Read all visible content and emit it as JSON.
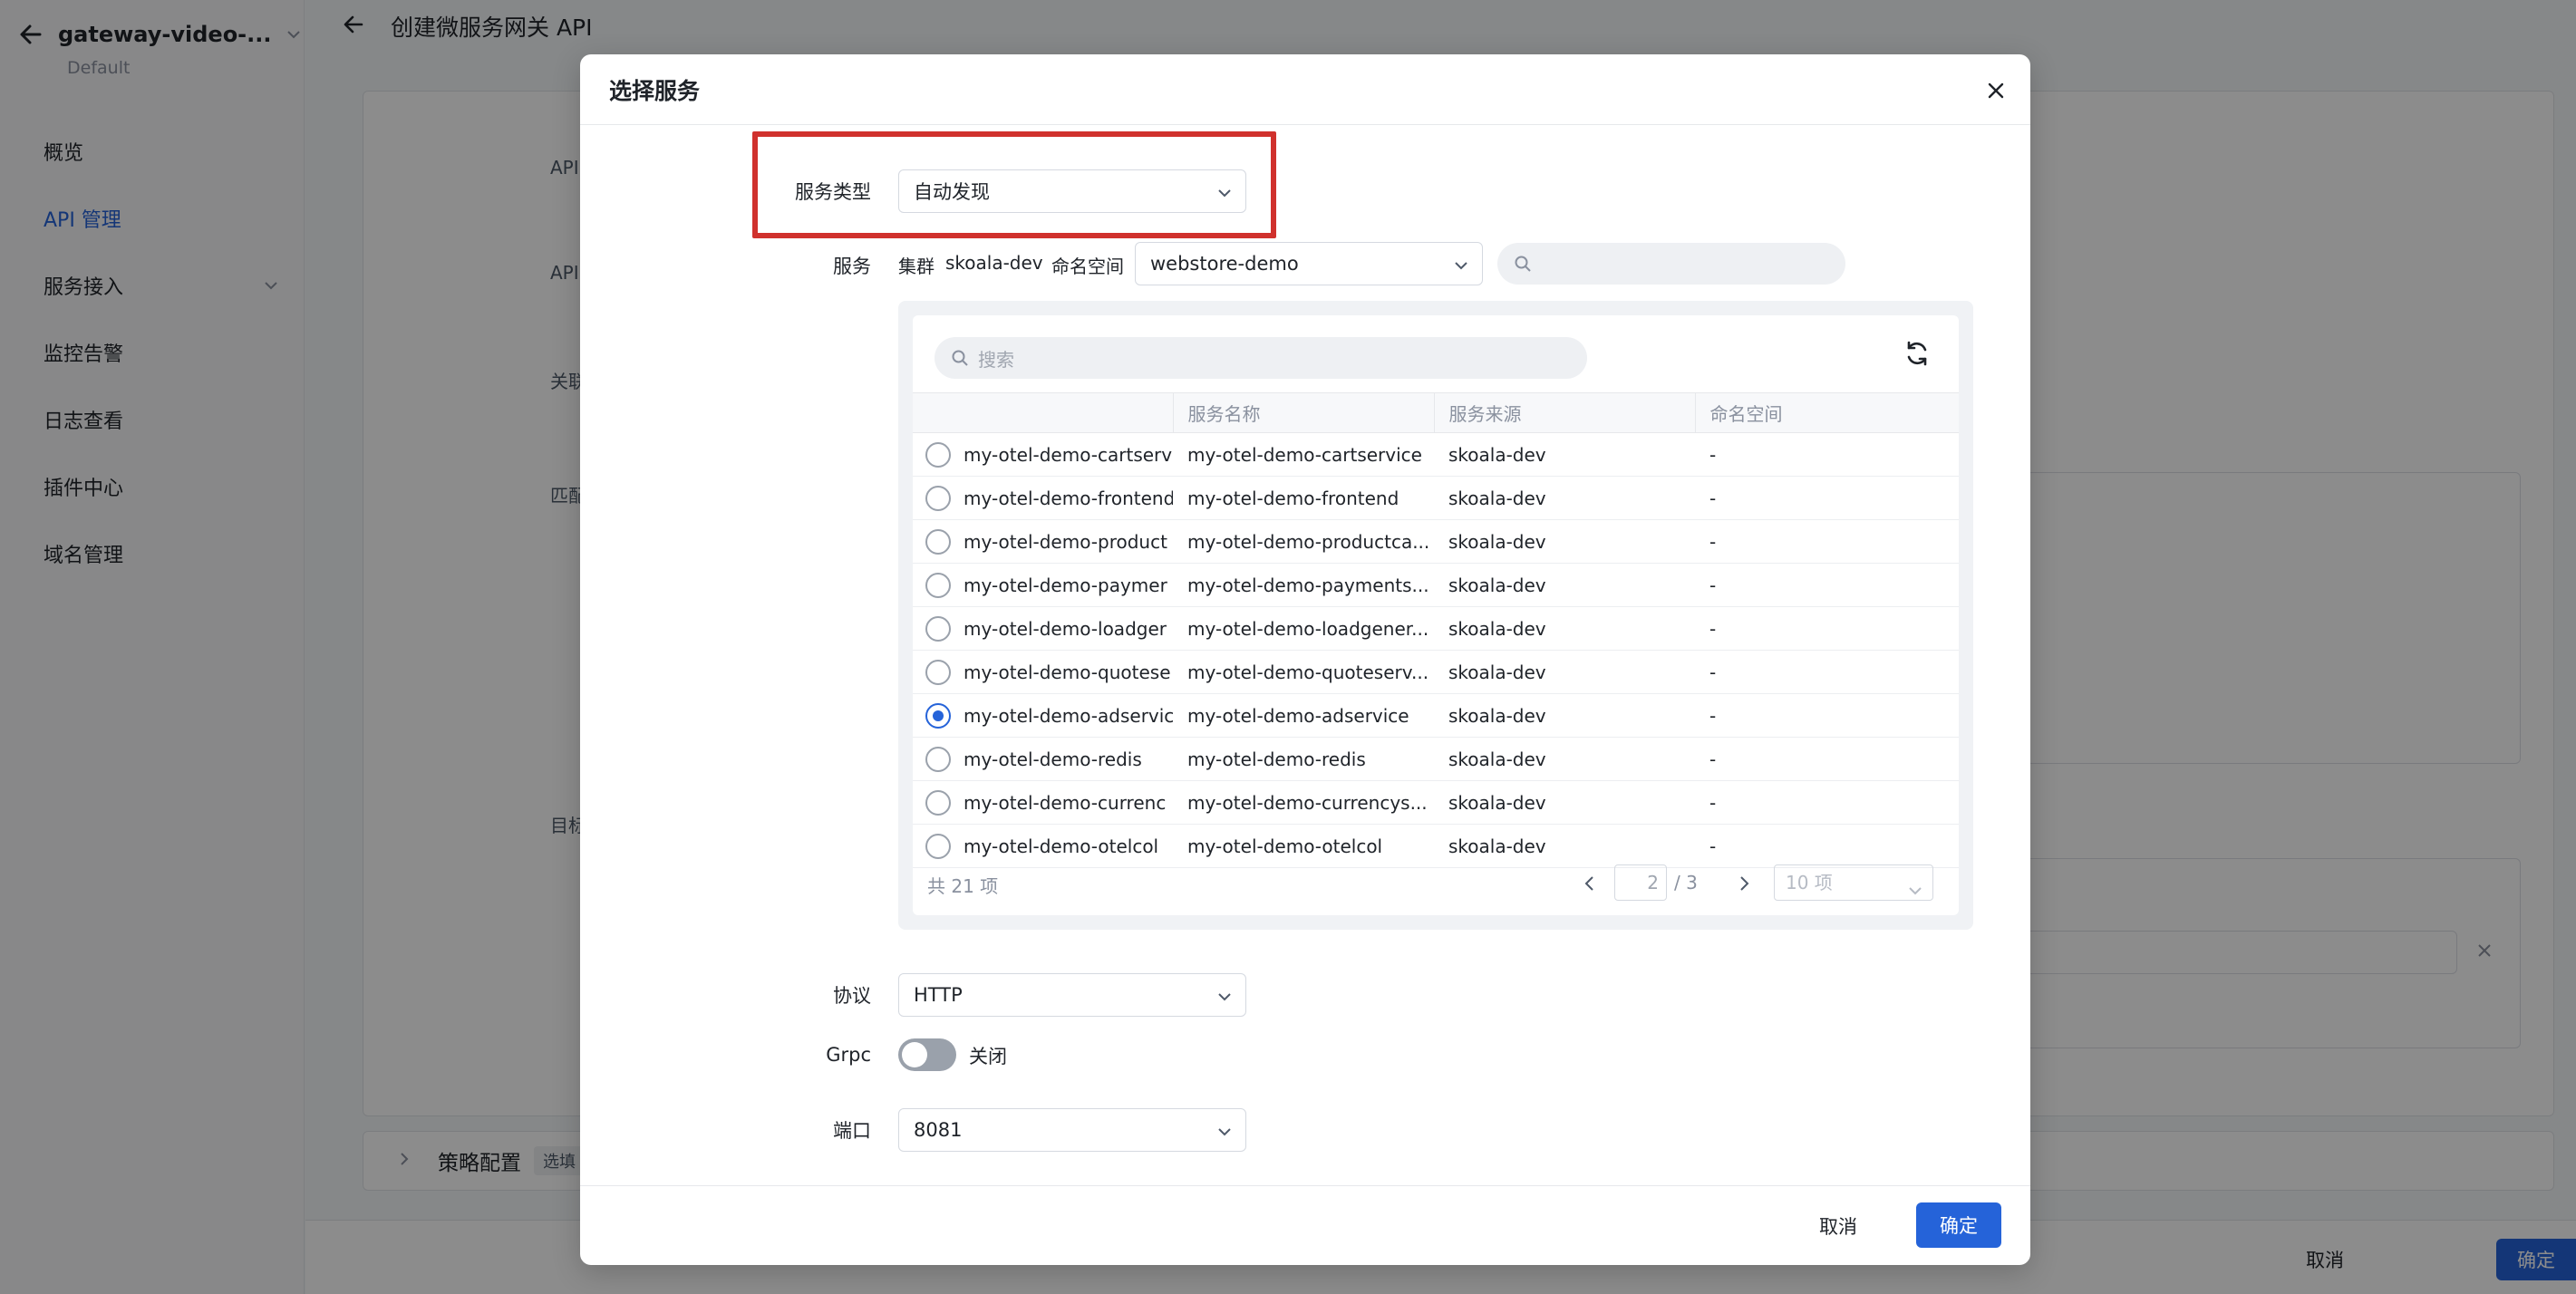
{
  "app": {
    "project_name": "gateway-video-...",
    "workspace": "Default",
    "page_title": "创建微服务网关 API",
    "menu": [
      {
        "label": "概览"
      },
      {
        "label": "API 管理"
      },
      {
        "label": "服务接入"
      },
      {
        "label": "监控告警"
      },
      {
        "label": "日志查看"
      },
      {
        "label": "插件中心"
      },
      {
        "label": "域名管理"
      }
    ],
    "bg_labels": {
      "api1": "API",
      "api2": "API",
      "assoc": "关联",
      "match": "匹配",
      "target": "目标"
    },
    "strategy": {
      "title": "策略配置",
      "tag": "选填"
    },
    "footer": {
      "cancel": "取消",
      "ok": "确定"
    }
  },
  "modal": {
    "title": "选择服务",
    "service_type": {
      "label": "服务类型",
      "value": "自动发现"
    },
    "service": {
      "label": "服务",
      "cluster_label": "集群",
      "cluster_value": "skoala-dev",
      "namespace_label": "命名空间",
      "namespace_value": "webstore-demo",
      "search_placeholder": ""
    },
    "table": {
      "search_placeholder": "搜索",
      "columns": [
        "",
        "服务名称",
        "服务来源",
        "命名空间"
      ],
      "rows": [
        {
          "id": "my-otel-demo-cartserv",
          "name": "my-otel-demo-cartservice",
          "source": "skoala-dev",
          "namespace": "-",
          "selected": false
        },
        {
          "id": "my-otel-demo-frontend",
          "name": "my-otel-demo-frontend",
          "source": "skoala-dev",
          "namespace": "-",
          "selected": false
        },
        {
          "id": "my-otel-demo-product",
          "name": "my-otel-demo-productca...",
          "source": "skoala-dev",
          "namespace": "-",
          "selected": false
        },
        {
          "id": "my-otel-demo-paymer",
          "name": "my-otel-demo-payments...",
          "source": "skoala-dev",
          "namespace": "-",
          "selected": false
        },
        {
          "id": "my-otel-demo-loadger",
          "name": "my-otel-demo-loadgener...",
          "source": "skoala-dev",
          "namespace": "-",
          "selected": false
        },
        {
          "id": "my-otel-demo-quotese",
          "name": "my-otel-demo-quoteserv...",
          "source": "skoala-dev",
          "namespace": "-",
          "selected": false
        },
        {
          "id": "my-otel-demo-adservic",
          "name": "my-otel-demo-adservice",
          "source": "skoala-dev",
          "namespace": "-",
          "selected": true
        },
        {
          "id": "my-otel-demo-redis",
          "name": "my-otel-demo-redis",
          "source": "skoala-dev",
          "namespace": "-",
          "selected": false
        },
        {
          "id": "my-otel-demo-currenc",
          "name": "my-otel-demo-currencys...",
          "source": "skoala-dev",
          "namespace": "-",
          "selected": false
        },
        {
          "id": "my-otel-demo-otelcol",
          "name": "my-otel-demo-otelcol",
          "source": "skoala-dev",
          "namespace": "-",
          "selected": false
        }
      ],
      "total": "共 21 项",
      "page": "2",
      "page_of": "/ 3",
      "page_size": "10 项"
    },
    "protocol": {
      "label": "协议",
      "value": "HTTP"
    },
    "grpc": {
      "label": "Grpc",
      "state": "关闭",
      "enabled": false
    },
    "port": {
      "label": "端口",
      "value": "8081"
    },
    "cancel": "取消",
    "ok": "确定"
  },
  "colors": {
    "accent": "#2563d9",
    "highlight": "#d0312d"
  }
}
